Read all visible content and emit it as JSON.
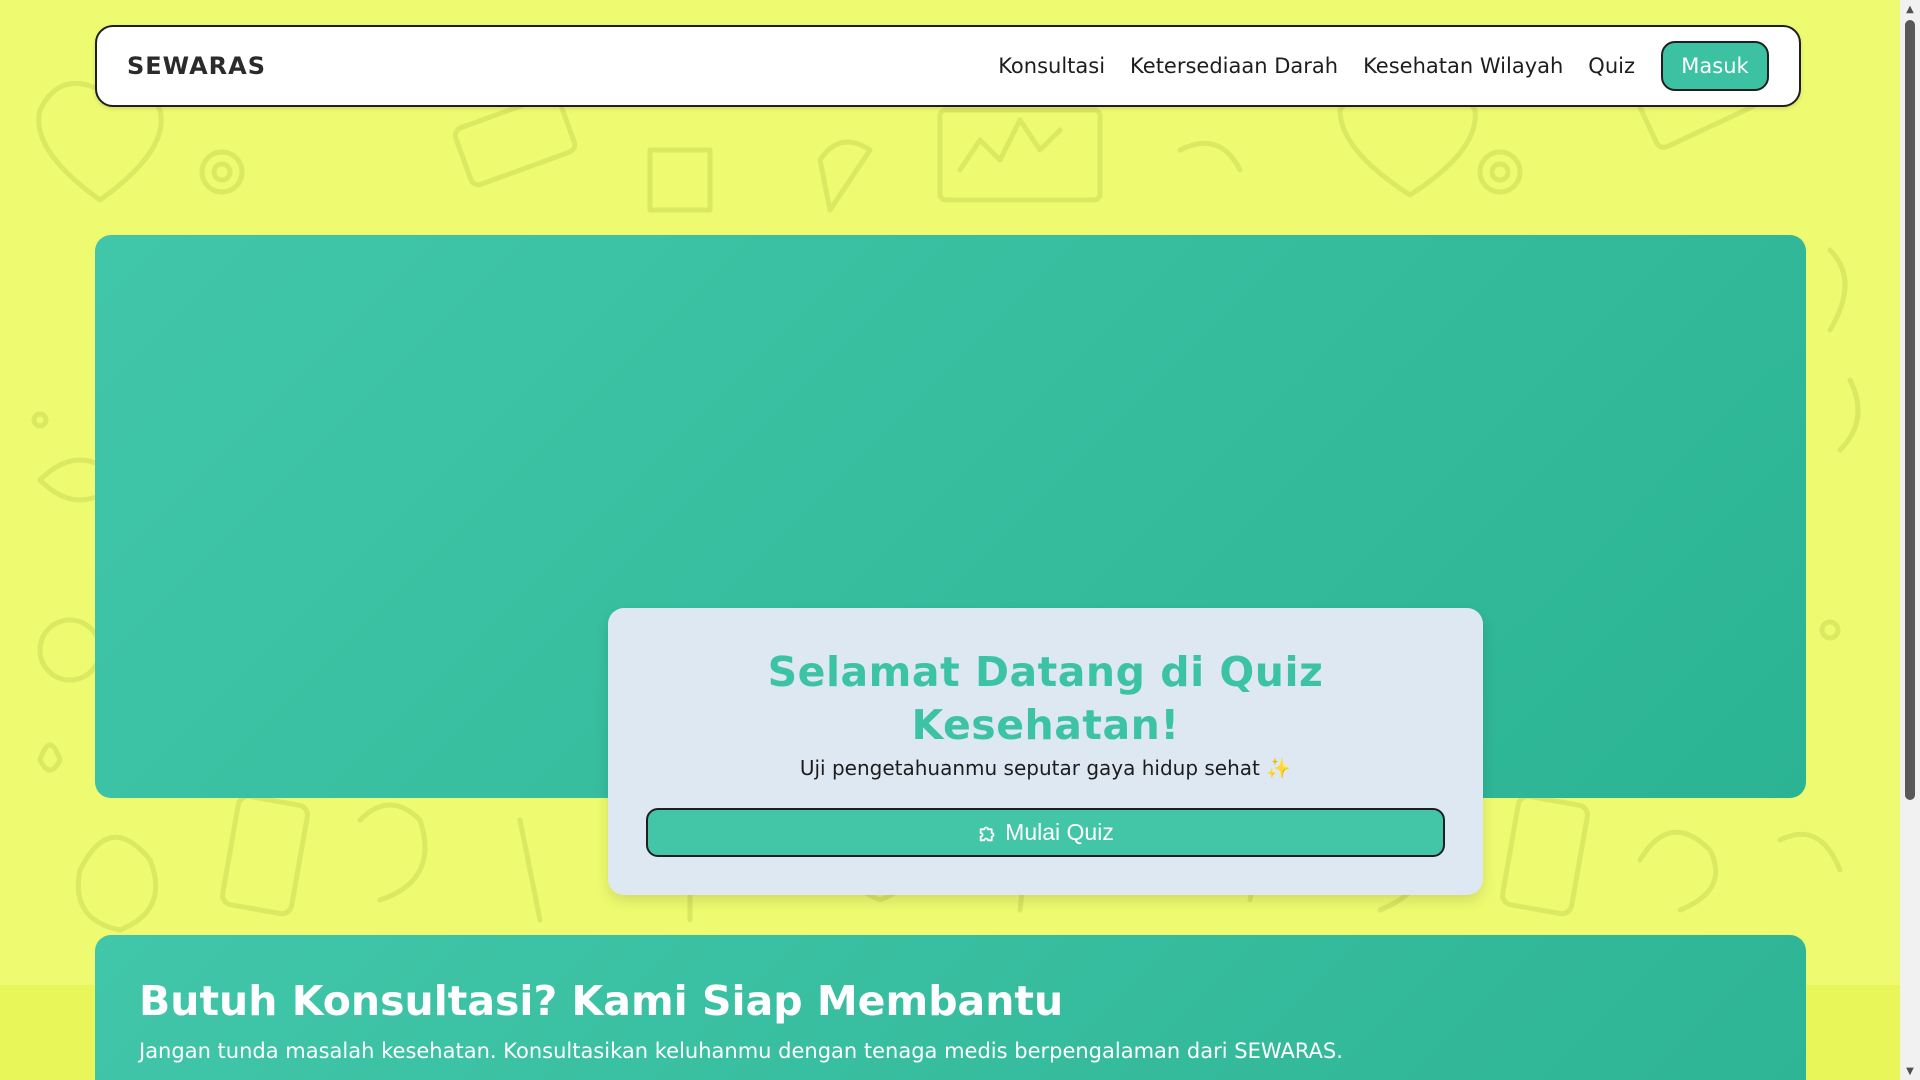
{
  "colors": {
    "background": "#eefb70",
    "accent": "#3cc2a3",
    "card": "#dde8f3",
    "title": "#3cc3a5"
  },
  "navbar": {
    "brand": "SEWARAS",
    "links": [
      "Konsultasi",
      "Ketersediaan Darah",
      "Kesehatan Wilayah",
      "Quiz"
    ],
    "login_label": "Masuk"
  },
  "quiz": {
    "title_line1": "Selamat Datang di Quiz",
    "title_line2": "Kesehatan!",
    "subtitle": "Uji pengetahuanmu seputar gaya hidup sehat ✨",
    "start_icon": "puzzle-icon",
    "start_label": "Mulai Quiz"
  },
  "consultation": {
    "title": "Butuh Konsultasi? Kami Siap Membantu",
    "description": "Jangan tunda masalah kesehatan. Konsultasikan keluhanmu dengan tenaga medis berpengalaman dari SEWARAS."
  }
}
